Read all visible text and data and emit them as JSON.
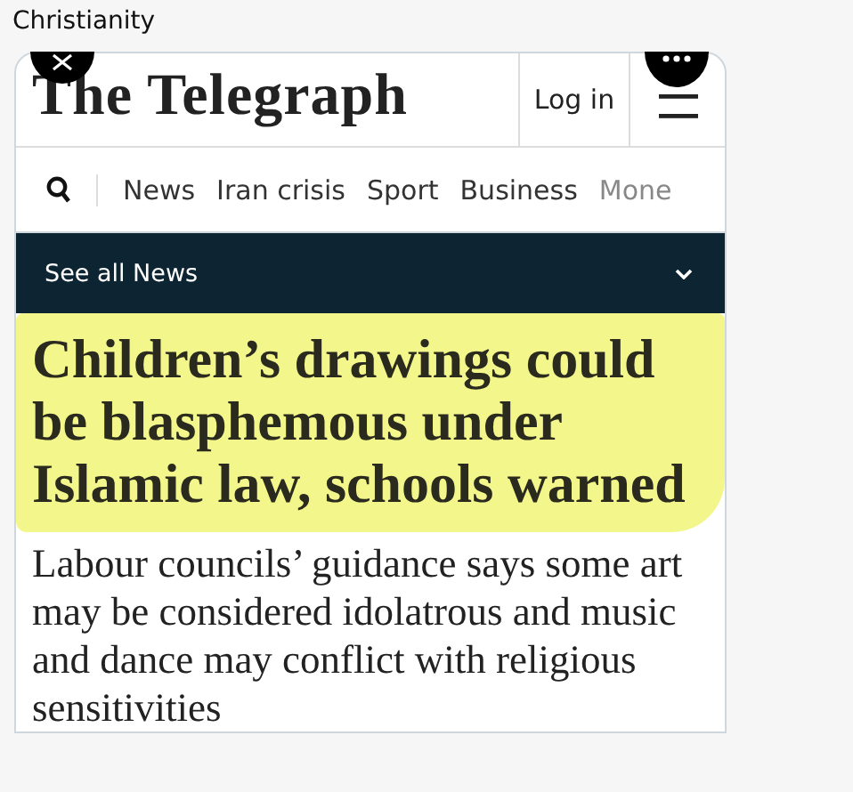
{
  "caption": "Christianity",
  "header": {
    "logo": "The Telegraph",
    "login": "Log in"
  },
  "nav": {
    "items": [
      "News",
      "Iran crisis",
      "Sport",
      "Business",
      "Mone"
    ]
  },
  "section_bar": {
    "label": "See all News"
  },
  "article": {
    "headline": "Children’s drawings could be blasphemous under Islamic law, schools warned",
    "headline_highlighted": true,
    "standfirst": "Labour councils’ guidance says some art may be considered idolatrous and music and dance may conflict with religious sensitivities"
  }
}
